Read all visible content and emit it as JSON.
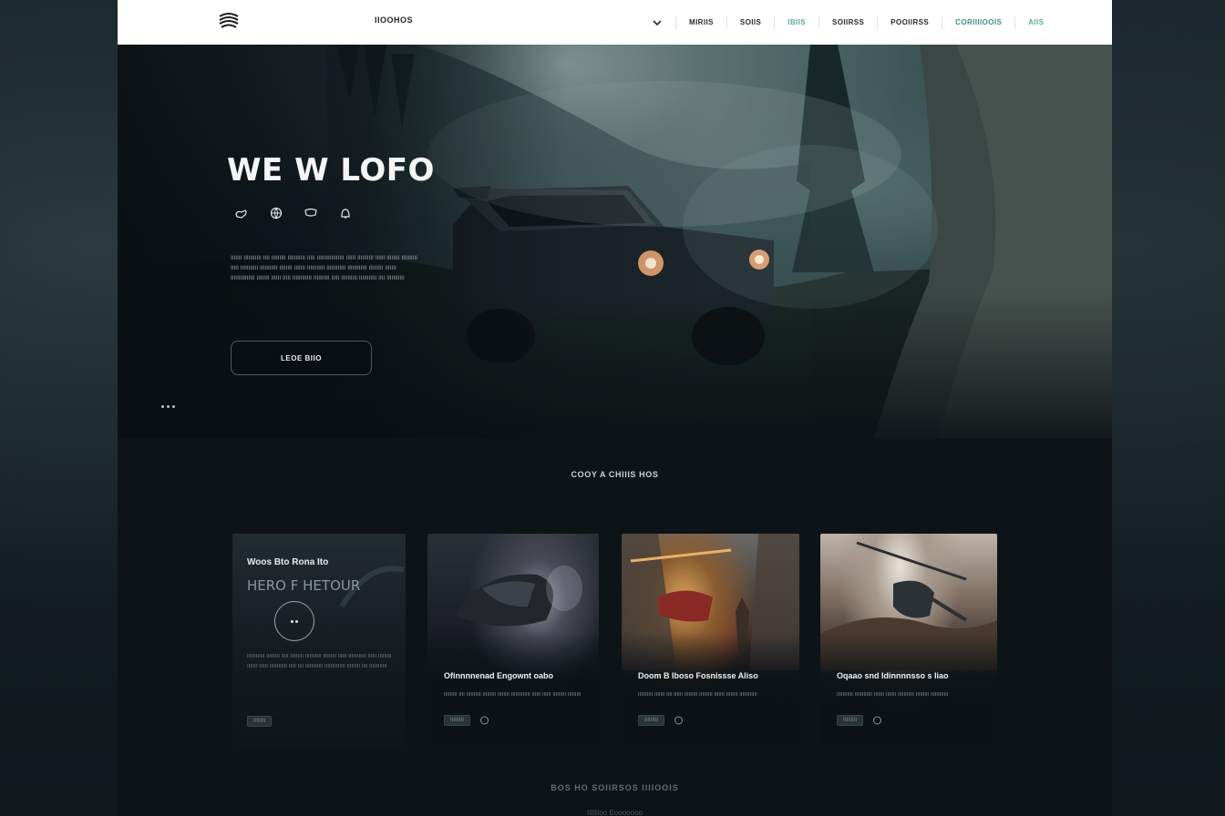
{
  "nav": {
    "brand": "IIOOHOS",
    "links": [
      "MIRIIS",
      "SOIIS",
      "IBIIS",
      "SOIIRSS",
      "POOIIRSS",
      "CORIIIIOOIS",
      "AIIS"
    ]
  },
  "hero": {
    "title": "WE W LOFO",
    "icons": [
      "hand-icon",
      "globe-icon",
      "chat-icon",
      "bell-icon"
    ],
    "paragraph": "IIIIIII IIIIIIIIIII IIII IIIIIIIII IIIIIIIIIII IIIII IIIIIIIIIIIIIIIII IIIIII IIIIIIIIII IIIIII IIIIIIII IIIIIIIIII IIIII IIIIIIIIIII IIIIIIIIIII IIIIIIII IIIIIII IIIIIIIIIII IIIIIIIIIIII IIIIIIIIIIII IIIIIIIII IIIIIII IIIIIIIIIIIIIII IIIIIIII IIIIII IIIII IIIIIIIIIIII IIIIIIIIII IIIII IIIIIIIIII IIIIIIIIIII IIII IIIIIIIIIII",
    "button_label": "LEOE BIIO"
  },
  "section": {
    "title": "COOY A CHIIIS HOS"
  },
  "cards": [
    {
      "subtitle": "Woos Bto Rona Ito",
      "heading": "HERO F HETOUR",
      "text": "IIIIIIIIIIII IIIIIIIII IIIII IIIIIIIII IIIIIIIIIII IIIIIIIII IIIIII IIIIIIIIIIII IIIIII IIIIIIIII IIIIIII IIIIII IIIIIIIIIIII IIIII IIII IIIIIIIIIIII IIIIIIIIIIIIII IIIIIIIII IIII IIIIIIIIIIII",
      "tag": "IIIIIIII"
    },
    {
      "title": "Ofinnnnenad Engownt oabo",
      "desc": "IIIIIIIII IIII IIIIIIIIII IIIIIIIII IIIIIIII IIIIIIIIIIIII IIIIII IIIIII IIIIIIIII IIIIIIIII",
      "tag": "IIIIIIIII",
      "icon": "globe-icon"
    },
    {
      "title": "Doom B Iboso Fosnissse Aliso",
      "desc": "IIIIIIIIII IIIIIII IIII IIIIII IIIIIIIII IIIIIIIII IIIIIII IIIIIIII IIIIIIIIIIII",
      "tag": "IIIIIIIII",
      "icon": "globe-icon"
    },
    {
      "title": "Oqaao snd Idinnnnsso s Iiao",
      "desc": "IIIIIIIIIII IIIIIIIIIIII IIIIIII IIIIIII IIIIIIIIIII IIIIIIIII IIIIIIIIIIII",
      "tag": "IIIIIIIII",
      "icon": "globe-icon"
    }
  ],
  "footer": {
    "title": "BOS HO SOIIRSOS IIIIOOIS",
    "subtitle": "IIIIIIoo Eooooooo"
  }
}
